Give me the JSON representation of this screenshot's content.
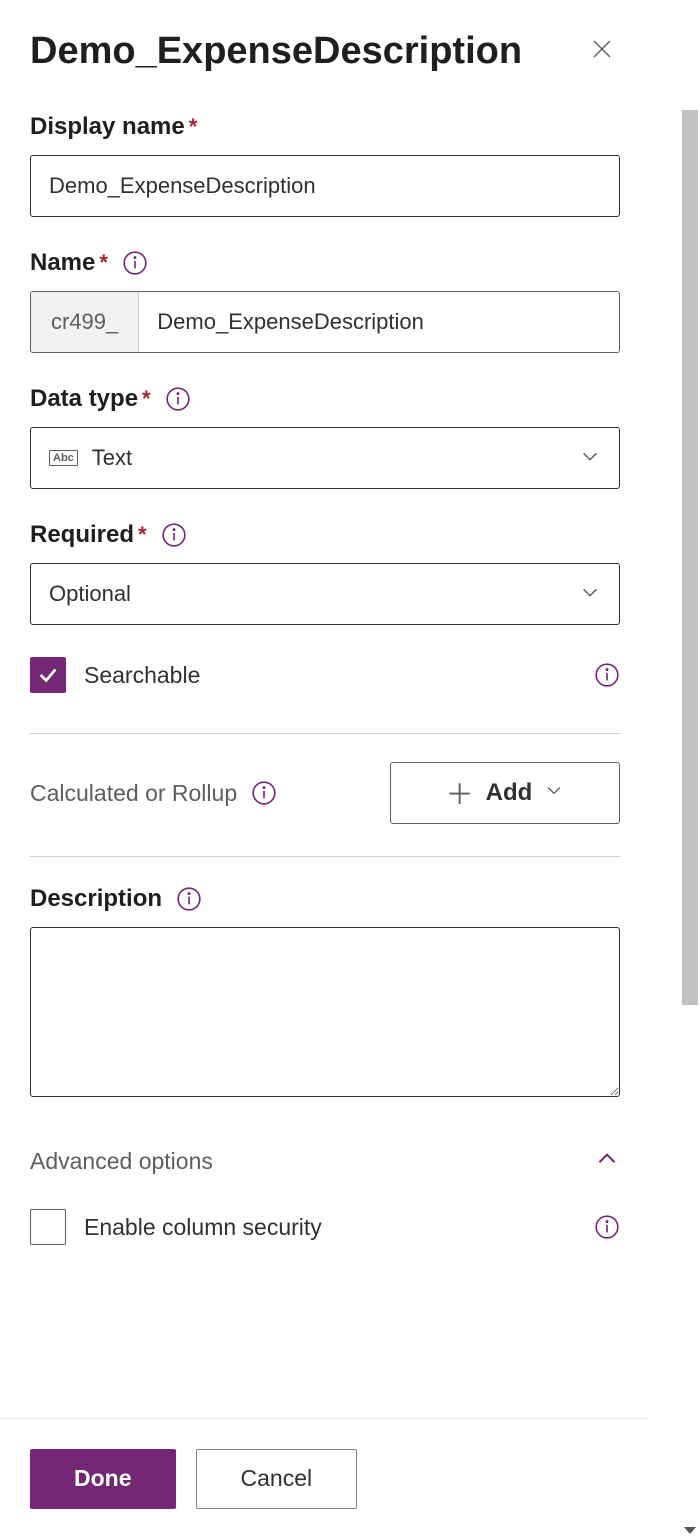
{
  "panel": {
    "title": "Demo_ExpenseDescription"
  },
  "fields": {
    "displayName": {
      "label": "Display name",
      "required": true,
      "value": "Demo_ExpenseDescription"
    },
    "name": {
      "label": "Name",
      "required": true,
      "prefix": "cr499_",
      "value": "Demo_ExpenseDescription"
    },
    "dataType": {
      "label": "Data type",
      "required": true,
      "value": "Text"
    },
    "requiredLevel": {
      "label": "Required",
      "required": true,
      "value": "Optional"
    },
    "searchable": {
      "label": "Searchable",
      "checked": true
    },
    "calculatedRollup": {
      "label": "Calculated or Rollup",
      "addLabel": "Add"
    },
    "description": {
      "label": "Description",
      "value": ""
    },
    "advancedOptions": {
      "label": "Advanced options",
      "expanded": true
    },
    "enableColumnSecurity": {
      "label": "Enable column security",
      "checked": false
    }
  },
  "footer": {
    "done": "Done",
    "cancel": "Cancel"
  }
}
